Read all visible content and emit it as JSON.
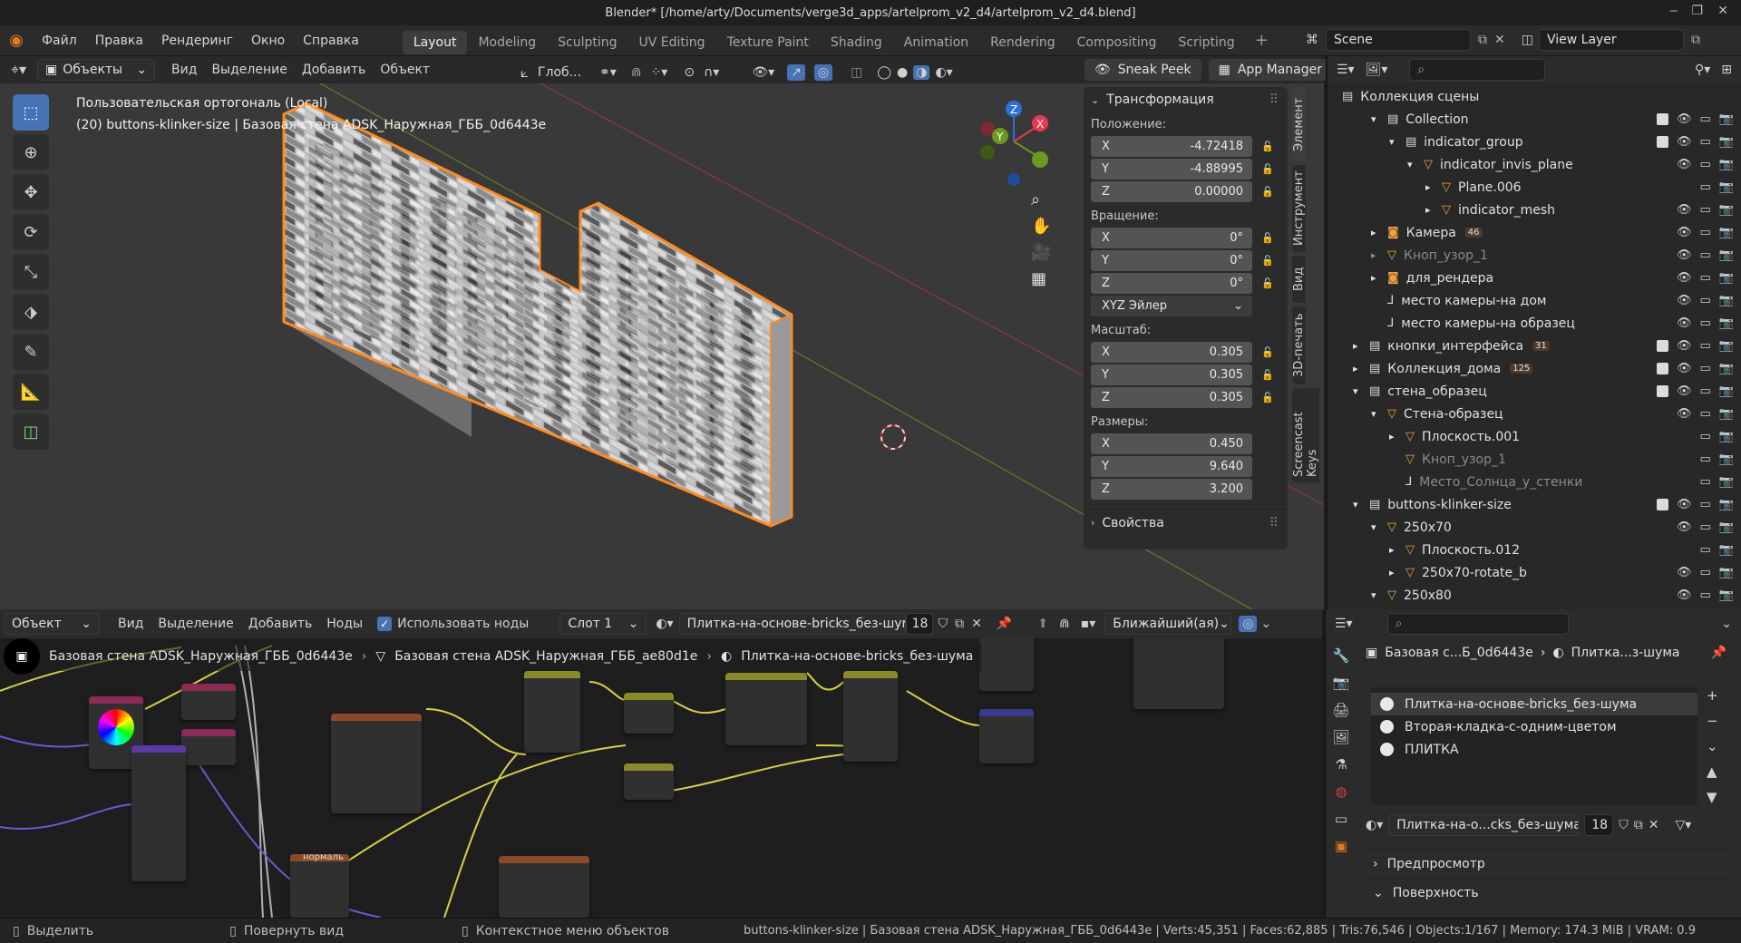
{
  "window": {
    "title": "Blender* [/home/arty/Documents/verge3d_apps/artelprom_v2_d4/artelprom_v2_d4.blend]"
  },
  "menu": [
    "Файл",
    "Правка",
    "Рендеринг",
    "Окно",
    "Справка"
  ],
  "workspaces": [
    "Layout",
    "Modeling",
    "Sculpting",
    "UV Editing",
    "Texture Paint",
    "Shading",
    "Animation",
    "Rendering",
    "Compositing",
    "Scripting"
  ],
  "scene": {
    "name": "Scene",
    "view_layer": "View Layer"
  },
  "viewport": {
    "mode": "Объекты",
    "header_menus": [
      "Вид",
      "Выделение",
      "Добавить",
      "Объект"
    ],
    "orientation": "Глоб...",
    "sneak_peek": "Sneak Peek",
    "app_manager": "App Manager",
    "overlay_title": "Пользовательская ортогональ (Local)",
    "overlay_subtitle": "(20) buttons-klinker-size | Базовая стена ADSK_Наружная_ГББ_0d6443e",
    "axes": {
      "x": "X",
      "y": "Y",
      "z": "Z"
    }
  },
  "npanel": {
    "section": "Трансформация",
    "location_label": "Положение:",
    "location": [
      [
        "X",
        "-4.72418"
      ],
      [
        "Y",
        "-4.88995"
      ],
      [
        "Z",
        "0.00000"
      ]
    ],
    "rotation_label": "Вращение:",
    "rotation": [
      [
        "X",
        "0°"
      ],
      [
        "Y",
        "0°"
      ],
      [
        "Z",
        "0°"
      ]
    ],
    "rotation_mode": "XYZ Эйлер",
    "scale_label": "Масштаб:",
    "scale": [
      [
        "X",
        "0.305"
      ],
      [
        "Y",
        "0.305"
      ],
      [
        "Z",
        "0.305"
      ]
    ],
    "dimensions_label": "Размеры:",
    "dimensions": [
      [
        "X",
        "0.450"
      ],
      [
        "Y",
        "9.640"
      ],
      [
        "Z",
        "3.200"
      ]
    ],
    "properties": "Свойства",
    "tabs": [
      "Элемент",
      "Инструмент",
      "Вид",
      "3D-печать",
      "Screencast Keys"
    ]
  },
  "outliner": {
    "root": "Коллекция сцены",
    "rows": [
      {
        "indent": 1,
        "arrow": "▾",
        "icon": "▤",
        "label": "Collection",
        "checkbox": true
      },
      {
        "indent": 2,
        "arrow": "▾",
        "icon": "▤",
        "label": "indicator_group",
        "checkbox": true
      },
      {
        "indent": 3,
        "arrow": "▾",
        "icon": "▽",
        "label": "indicator_invis_plane"
      },
      {
        "indent": 4,
        "arrow": "▸",
        "icon": "▽",
        "label": "Plane.006",
        "noeye": true
      },
      {
        "indent": 4,
        "arrow": "▸",
        "icon": "▽",
        "label": "indicator_mesh"
      },
      {
        "indent": 1,
        "arrow": "▸",
        "icon": "◙",
        "label": "Камера",
        "badge": "46"
      },
      {
        "indent": 1,
        "arrow": "▸",
        "icon": "▽",
        "label": "Кноп_узор_1",
        "dim": true
      },
      {
        "indent": 1,
        "arrow": "▸",
        "icon": "◙",
        "label": "для_рендера"
      },
      {
        "indent": 1,
        "arrow": "",
        "icon": "⅃",
        "label": "место камеры-на дом"
      },
      {
        "indent": 1,
        "arrow": "",
        "icon": "⅃",
        "label": "место камеры-на образец"
      },
      {
        "indent": 0,
        "arrow": "▸",
        "icon": "▤",
        "label": "кнопки_интерфейса",
        "checkbox": true,
        "badge": "31"
      },
      {
        "indent": 0,
        "arrow": "▸",
        "icon": "▤",
        "label": "Коллекция_дома",
        "checkbox": true,
        "badge": "125"
      },
      {
        "indent": 0,
        "arrow": "▾",
        "icon": "▤",
        "label": "стена_образец",
        "checkbox": true
      },
      {
        "indent": 1,
        "arrow": "▾",
        "icon": "▽",
        "label": "Стена-образец"
      },
      {
        "indent": 2,
        "arrow": "▸",
        "icon": "▽",
        "label": "Плоскость.001",
        "noeye": true
      },
      {
        "indent": 2,
        "arrow": "",
        "icon": "▽",
        "label": "Кноп_узор_1",
        "dim": true,
        "noeye": true
      },
      {
        "indent": 2,
        "arrow": "",
        "icon": "⅃",
        "label": "Место_Солнца_у_стенки",
        "dim": true,
        "noeye": true
      },
      {
        "indent": 0,
        "arrow": "▾",
        "icon": "▤",
        "label": "buttons-klinker-size",
        "checkbox": true
      },
      {
        "indent": 1,
        "arrow": "▾",
        "icon": "▽",
        "label": "250x70"
      },
      {
        "indent": 2,
        "arrow": "▸",
        "icon": "▽",
        "label": "Плоскость.012",
        "noeye": true
      },
      {
        "indent": 2,
        "arrow": "▸",
        "icon": "▽",
        "label": "250x70-rotate_b"
      },
      {
        "indent": 1,
        "arrow": "▾",
        "icon": "▽",
        "label": "250x80"
      }
    ]
  },
  "node_editor": {
    "mode": "Объект",
    "menus": [
      "Вид",
      "Выделение",
      "Добавить",
      "Ноды"
    ],
    "use_nodes": "Использовать ноды",
    "slot": "Слот 1",
    "material": "Плитка-на-основе-bricks_без-шума",
    "users": "18",
    "interpolation": "Ближайший(ая)",
    "breadcrumb": [
      "Базовая стена ADSK_Наружная_ГББ_0d6443e",
      "Базовая стена ADSK_Наружная_ГББ_ae80d1e",
      "Плитка-на-основе-bricks_без-шума"
    ],
    "frame_label": "нормаль"
  },
  "properties": {
    "breadcrumb_obj": "Базовая с...Б_0d6443e",
    "breadcrumb_mat": "Плитка...з-шума",
    "materials": [
      "Плитка-на-основе-bricks_без-шума",
      "Вторая-кладка-с-одним-цветом",
      "ПЛИТКА"
    ],
    "material_field": "Плитка-на-о...cks_без-шума",
    "users": "18",
    "sections": [
      "Предпросмотр",
      "Поверхность"
    ]
  },
  "status": {
    "select": "Выделить",
    "rotate": "Повернуть вид",
    "context": "Контекстное меню объектов",
    "info": "buttons-klinker-size | Базовая стена ADSK_Наружная_ГББ_0d6443e | Verts:45,351 | Faces:62,885 | Tris:76,546 | Objects:1/167 | Memory: 174.3 MiB | VRAM: 0.9"
  },
  "colors": {
    "accent": "#4772b3",
    "selection": "#ff8a1f",
    "x_axis": "#e8384f",
    "y_axis": "#6b9a1f",
    "z_axis": "#2f6fd6"
  }
}
